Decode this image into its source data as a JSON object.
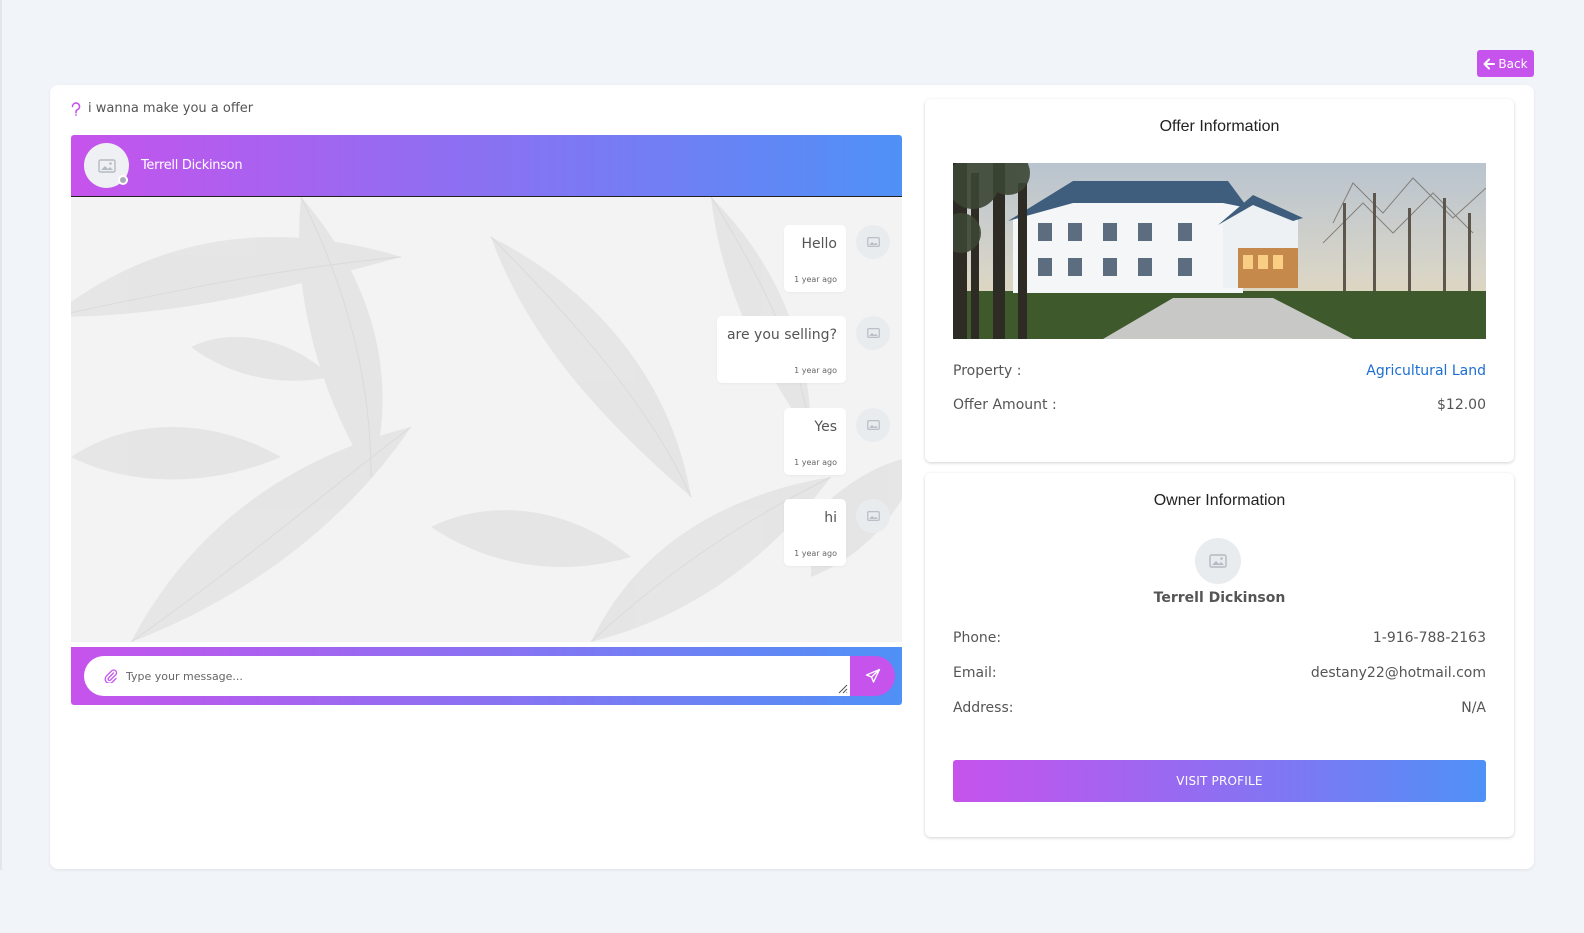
{
  "header": {
    "back_label": "Back"
  },
  "conversation": {
    "subject": "i wanna make you a offer",
    "contact_name": "Terrell Dickinson",
    "messages": [
      {
        "text": "Hello",
        "time": "1 year ago"
      },
      {
        "text": "are you selling?",
        "time": "1 year ago"
      },
      {
        "text": "Yes",
        "time": "1 year ago"
      },
      {
        "text": "hi",
        "time": "1 year ago"
      }
    ],
    "composer_placeholder": "Type your message..."
  },
  "offer": {
    "title": "Offer Information",
    "property_label": "Property :",
    "property_value": "Agricultural Land",
    "amount_label": "Offer Amount :",
    "amount_value": "$12.00"
  },
  "owner": {
    "title": "Owner Information",
    "name": "Terrell Dickinson",
    "phone_label": "Phone:",
    "phone": "1-916-788-2163",
    "email_label": "Email:",
    "email": "destany22@hotmail.com",
    "address_label": "Address:",
    "address": "N/A",
    "visit_label": "VISIT PROFILE"
  },
  "colors": {
    "accent": "#c653ec",
    "gradient_end": "#4f91f6",
    "link": "#1c6fd1"
  }
}
